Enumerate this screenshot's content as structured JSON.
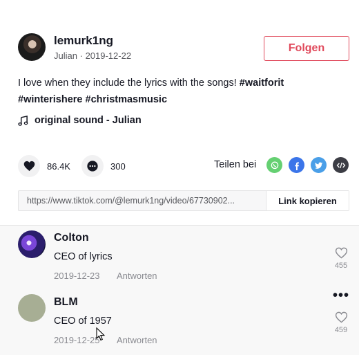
{
  "header": {
    "username": "lemurk1ng",
    "display_name": "Julian",
    "separator": "·",
    "date": "2019-12-22",
    "follow_label": "Folgen"
  },
  "caption": {
    "text": "I love when they include the lyrics with the songs!",
    "hashtags": [
      "#waitforit",
      "#winterishere",
      "#christmasmusic"
    ]
  },
  "music": {
    "icon": "music-note-icon",
    "label": "original sound - Julian"
  },
  "stats": {
    "likes": "86.4K",
    "comments": "300"
  },
  "share": {
    "label": "Teilen bei",
    "icons": [
      "whatsapp-icon",
      "facebook-icon",
      "twitter-icon",
      "embed-icon"
    ]
  },
  "link": {
    "url": "https://www.tiktok.com/@lemurk1ng/video/67730902...",
    "copy_label": "Link kopieren"
  },
  "comments": [
    {
      "author": "Colton",
      "text": "CEO of lyrics",
      "date": "2019-12-23",
      "reply_label": "Antworten",
      "likes": "455"
    },
    {
      "author": "BLM",
      "text": "CEO of 1957",
      "date": "2019-12-25",
      "reply_label": "Antworten",
      "likes": "459"
    }
  ],
  "colors": {
    "accent": "#e0485a",
    "whatsapp": "#65d072",
    "facebook": "#3b75e9",
    "twitter": "#4a9fe8",
    "embed": "#3c3d45"
  }
}
